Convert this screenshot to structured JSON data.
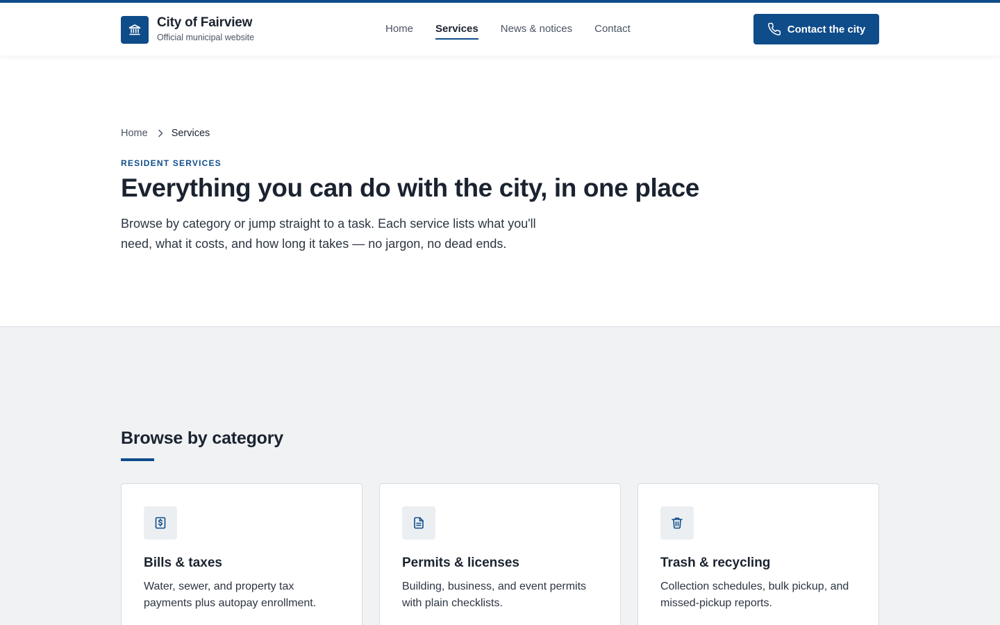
{
  "colors": {
    "brand": "#0f4c8a",
    "text": "#1b2330",
    "muted": "#4a5463",
    "section_bg": "#f0f2f4"
  },
  "header": {
    "logo_icon": "building-columns-icon",
    "site_name": "City of Fairview",
    "site_tagline": "Official municipal website",
    "nav": [
      {
        "label": "Home",
        "active": false
      },
      {
        "label": "Services",
        "active": true
      },
      {
        "label": "News & notices",
        "active": false
      },
      {
        "label": "Contact",
        "active": false
      }
    ],
    "cta": {
      "label": "Contact the city",
      "icon": "phone-icon"
    }
  },
  "breadcrumb": {
    "home": "Home",
    "separator_icon": "chevron-right-icon",
    "current": "Services"
  },
  "hero": {
    "eyebrow": "Resident services",
    "title": "Everything you can do with the city, in one place",
    "lead": "Browse by category or jump straight to a task. Each service lists what you'll need, what it costs, and how long it takes — no jargon, no dead ends."
  },
  "categories": {
    "title": "Browse by category",
    "items": [
      {
        "icon": "dollar-receipt-icon",
        "title": "Bills & taxes",
        "description": "Water, sewer, and property tax payments plus autopay enrollment."
      },
      {
        "icon": "document-icon",
        "title": "Permits & licenses",
        "description": "Building, business, and event permits with plain checklists."
      },
      {
        "icon": "trash-can-icon",
        "title": "Trash & recycling",
        "description": "Collection schedules, bulk pickup, and missed-pickup reports."
      }
    ]
  }
}
